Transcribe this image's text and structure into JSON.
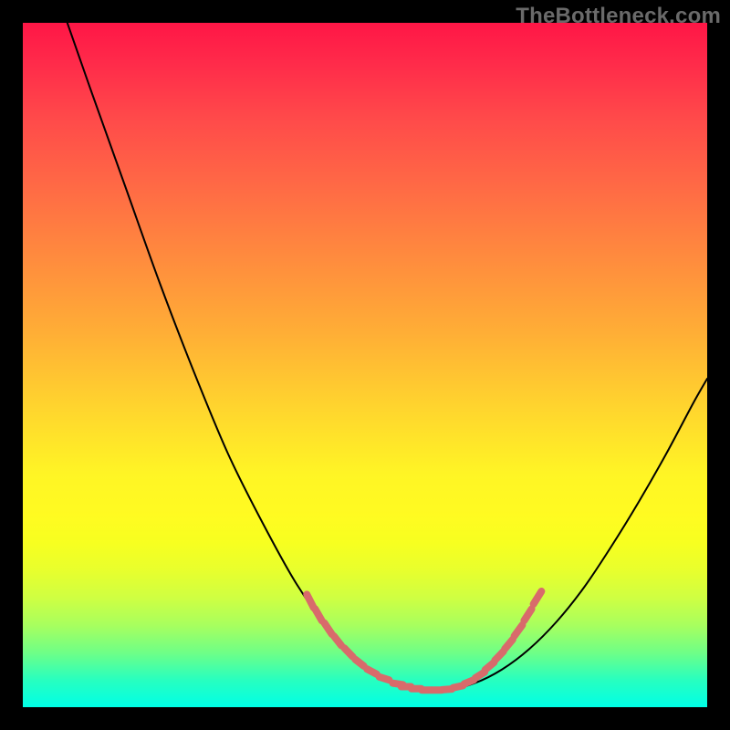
{
  "watermark": "TheBottleneck.com",
  "colors": {
    "curve_stroke": "#000000",
    "hatch_stroke": "#d86b6b",
    "frame_bg": "#000000"
  },
  "chart_data": {
    "type": "line",
    "title": "",
    "xlabel": "",
    "ylabel": "",
    "xlim": [
      0,
      1
    ],
    "ylim": [
      0,
      1
    ],
    "grid": false,
    "legend": false,
    "series": [
      {
        "name": "bottleneck_curve",
        "x": [
          0.065,
          0.1,
          0.15,
          0.2,
          0.25,
          0.3,
          0.35,
          0.4,
          0.45,
          0.5,
          0.54,
          0.58,
          0.62,
          0.66,
          0.7,
          0.74,
          0.78,
          0.82,
          0.86,
          0.9,
          0.94,
          0.98,
          1.0
        ],
        "y": [
          1.0,
          0.9,
          0.76,
          0.62,
          0.49,
          0.37,
          0.27,
          0.18,
          0.11,
          0.06,
          0.035,
          0.025,
          0.025,
          0.035,
          0.055,
          0.085,
          0.125,
          0.175,
          0.235,
          0.3,
          0.37,
          0.445,
          0.48
        ]
      }
    ],
    "annotations": [
      {
        "name": "valley_hatches",
        "type": "scatter_hatch",
        "note": "short salmon tick marks along curve near the valley on both slopes and floor",
        "segments": [
          {
            "x": 0.42,
            "y": 0.155,
            "len": 0.022,
            "ang_deg": -63
          },
          {
            "x": 0.432,
            "y": 0.135,
            "len": 0.02,
            "ang_deg": -60
          },
          {
            "x": 0.446,
            "y": 0.115,
            "len": 0.02,
            "ang_deg": -56
          },
          {
            "x": 0.46,
            "y": 0.097,
            "len": 0.018,
            "ang_deg": -52
          },
          {
            "x": 0.476,
            "y": 0.08,
            "len": 0.018,
            "ang_deg": -46
          },
          {
            "x": 0.492,
            "y": 0.065,
            "len": 0.016,
            "ang_deg": -38
          },
          {
            "x": 0.51,
            "y": 0.052,
            "len": 0.016,
            "ang_deg": -28
          },
          {
            "x": 0.528,
            "y": 0.042,
            "len": 0.015,
            "ang_deg": -18
          },
          {
            "x": 0.548,
            "y": 0.034,
            "len": 0.015,
            "ang_deg": -8
          },
          {
            "x": 0.56,
            "y": 0.03,
            "len": 0.014,
            "ang_deg": 0
          },
          {
            "x": 0.575,
            "y": 0.027,
            "len": 0.014,
            "ang_deg": 0
          },
          {
            "x": 0.59,
            "y": 0.025,
            "len": 0.014,
            "ang_deg": 0
          },
          {
            "x": 0.605,
            "y": 0.025,
            "len": 0.014,
            "ang_deg": 0
          },
          {
            "x": 0.62,
            "y": 0.026,
            "len": 0.014,
            "ang_deg": 4
          },
          {
            "x": 0.636,
            "y": 0.03,
            "len": 0.015,
            "ang_deg": 12
          },
          {
            "x": 0.652,
            "y": 0.037,
            "len": 0.015,
            "ang_deg": 22
          },
          {
            "x": 0.668,
            "y": 0.047,
            "len": 0.016,
            "ang_deg": 32
          },
          {
            "x": 0.682,
            "y": 0.06,
            "len": 0.017,
            "ang_deg": 40
          },
          {
            "x": 0.696,
            "y": 0.075,
            "len": 0.018,
            "ang_deg": 46
          },
          {
            "x": 0.71,
            "y": 0.092,
            "len": 0.018,
            "ang_deg": 50
          },
          {
            "x": 0.724,
            "y": 0.112,
            "len": 0.02,
            "ang_deg": 54
          },
          {
            "x": 0.738,
            "y": 0.135,
            "len": 0.02,
            "ang_deg": 57
          },
          {
            "x": 0.752,
            "y": 0.16,
            "len": 0.022,
            "ang_deg": 58
          }
        ]
      }
    ]
  }
}
